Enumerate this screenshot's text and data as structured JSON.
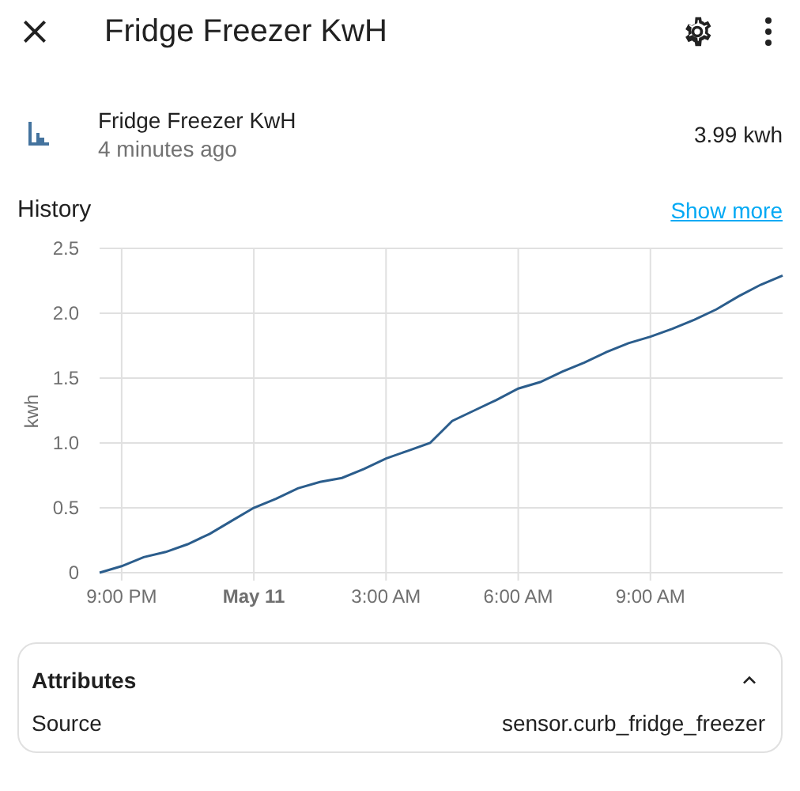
{
  "dialog": {
    "title": "Fridge Freezer KwH"
  },
  "entity": {
    "name": "Fridge Freezer KwH",
    "updated": "4 minutes ago",
    "state": "3.99 kwh"
  },
  "history": {
    "title": "History",
    "link": "Show more",
    "chart_data": {
      "type": "line",
      "grid": true,
      "ylabel": "kwh",
      "ylim": [
        0,
        2.5
      ],
      "categories": [
        null,
        "9:00 PM",
        null,
        null,
        null,
        null,
        null,
        "May 11",
        null,
        null,
        null,
        null,
        null,
        "3:00 AM",
        null,
        null,
        null,
        null,
        null,
        "6:00 AM",
        null,
        null,
        null,
        null,
        null,
        "9:00 AM",
        null,
        null,
        null,
        null,
        null,
        null
      ],
      "yticks": [
        {
          "value": 0,
          "label": "0"
        },
        {
          "value": 0.5,
          "label": "0.5"
        },
        {
          "value": 1,
          "label": "1.0"
        },
        {
          "value": 1.5,
          "label": "1.5"
        },
        {
          "value": 2,
          "label": "2.0"
        },
        {
          "value": 2.5,
          "label": "2.5"
        }
      ],
      "series": [
        {
          "color": "#2b5d8c",
          "values": [
            0,
            0.05,
            0.12,
            0.16,
            0.22,
            0.3,
            0.4,
            0.5,
            0.57,
            0.65,
            0.7,
            0.73,
            0.8,
            0.88,
            0.94,
            1.0,
            1.17,
            1.25,
            1.33,
            1.42,
            1.47,
            1.55,
            1.62,
            1.7,
            1.77,
            1.82,
            1.88,
            1.95,
            2.03,
            2.13,
            2.22,
            2.29
          ]
        }
      ]
    }
  },
  "attributes": {
    "title": "Attributes",
    "expanded": true,
    "rows": [
      {
        "label": "Source",
        "value": "sensor.curb_fridge_freezer"
      }
    ]
  }
}
